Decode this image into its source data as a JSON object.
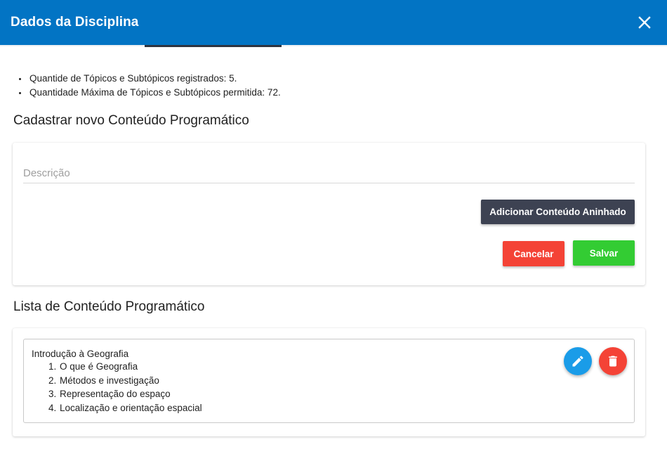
{
  "header": {
    "title": "Dados da Disciplina",
    "color": "#0274c4",
    "close_icon": "close-icon"
  },
  "info": {
    "items": [
      "Quantide de Tópicos e Subtópicos registrados: 5.",
      "Quantidade Máxima de Tópicos e Subtópicos permitida: 72."
    ]
  },
  "register": {
    "title": "Cadastrar novo Conteúdo Programático",
    "description_value": "",
    "description_placeholder": "Descrição",
    "nested_button_label": "Adicionar Conteúdo Aninhado",
    "cancel_label": "Cancelar",
    "save_label": "Salvar",
    "colors": {
      "nested": "#3d4252",
      "cancel": "#f44336",
      "save": "#33cc33"
    }
  },
  "list": {
    "title": "Lista de Conteúdo Programático",
    "topic": {
      "title": "Introdução à Geografia",
      "subtopics": [
        "O que é Geografia",
        "Métodos e investigação",
        "Representação do espaço",
        "Localização e orientação espacial"
      ]
    },
    "edit_icon": "pencil-icon",
    "delete_icon": "trash-icon",
    "colors": {
      "edit": "#1a9ce8",
      "delete": "#f44336"
    }
  }
}
